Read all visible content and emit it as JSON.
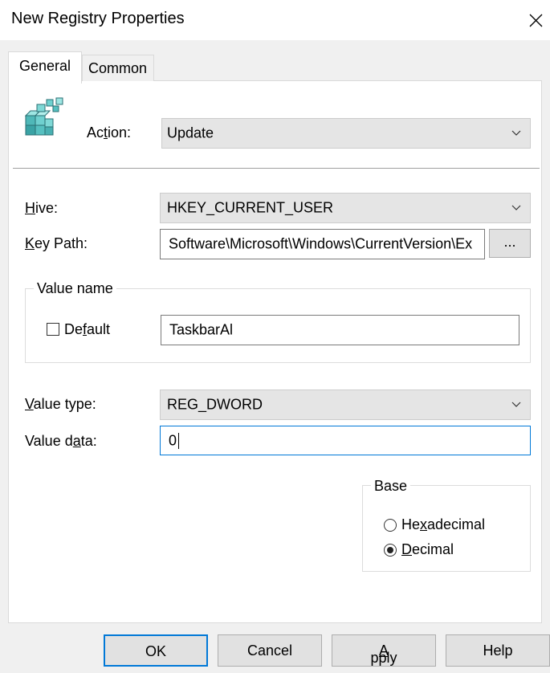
{
  "window": {
    "title": "New Registry Properties",
    "close_icon": "close-icon"
  },
  "tabs": [
    {
      "label": "General",
      "selected": true
    },
    {
      "label": "Common",
      "selected": false
    }
  ],
  "general": {
    "registry_icon": "registry-icon",
    "action": {
      "label_pre": "Ac",
      "label_accel": "t",
      "label_post": "ion:",
      "value": "Update"
    },
    "hive": {
      "label_accel": "H",
      "label_post": "ive:",
      "value": "HKEY_CURRENT_USER"
    },
    "key_path": {
      "label_accel": "K",
      "label_post": "ey Path:",
      "value": "Software\\Microsoft\\Windows\\CurrentVersion\\Ex",
      "browse_label": "..."
    },
    "value_name": {
      "group_title": "Value name",
      "default_label_pre": "De",
      "default_label_accel": "f",
      "default_label_post": "ault",
      "default_checked": false,
      "value": "TaskbarAl"
    },
    "value_type": {
      "label_accel": "V",
      "label_post": "alue type:",
      "value": "REG_DWORD"
    },
    "value_data": {
      "label_pre": "Value d",
      "label_accel": "a",
      "label_post": "ta:",
      "value": "0"
    },
    "base": {
      "group_title": "Base",
      "options": [
        {
          "label_pre": "He",
          "label_accel": "x",
          "label_post": "adecimal",
          "checked": false
        },
        {
          "label_pre": "",
          "label_accel": "D",
          "label_post": "ecimal",
          "checked": true
        }
      ]
    }
  },
  "buttons": {
    "ok": "OK",
    "cancel": "Cancel",
    "apply_accel": "A",
    "apply_post": "pply",
    "help": "Help"
  },
  "colors": {
    "accent": "#0078d7",
    "window_bg": "#f0f0f0",
    "panel_bg": "#ffffff"
  }
}
